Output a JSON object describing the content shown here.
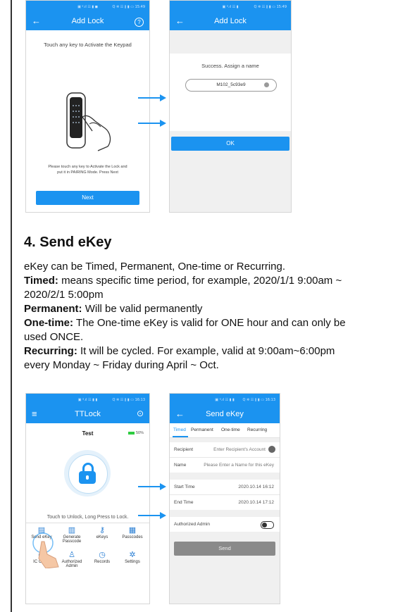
{
  "screens": {
    "add_lock_1": {
      "status": "▣ ᵍ.ıl ☷ ▮ ◼",
      "status_right": "Q ✲ ☷ ∦ ▮ ▭ 15:49",
      "title": "Add Lock",
      "back_icon": "←",
      "help_icon": "?",
      "instruction": "Touch any key to Activate the Keypad",
      "hint_line1": "Please touch any key to Activate the Lock and",
      "hint_line2": "put it in PAIRING Mode. Press Next",
      "next": "Next"
    },
    "add_lock_2": {
      "status": "▣ ᵍ.ıl ☷ ▮",
      "status_right": "Q ✲ ☷ ∦ ▮ ▭ 15:49",
      "title": "Add Lock",
      "back_icon": "←",
      "success": "Success. Assign a name",
      "name_value": "M102_5c93e9",
      "ok": "OK"
    },
    "ttlock": {
      "status": "▣ ᵍ.ıl ☷ ▮ ▮",
      "status_right": "Q ✲ ☷ ∦ ▮ ▭ 16:13",
      "title": "TTLock",
      "menu_icon": "≡",
      "scan_icon": "⊙",
      "lock_name": "Test",
      "battery": "50%",
      "unlock_hint": "Touch to Unlock, Long Press to Lock.",
      "grid": [
        "Send eKey",
        "Generate Passcode",
        "eKeys",
        "Passcodes",
        "IC Cards",
        "Authorized Admin",
        "Records",
        "Settings"
      ]
    },
    "send_ekey": {
      "status": "▣ ᵍ.ıl ☷ ▮ ▮",
      "status_right": "Q ✲ ☷ ∦ ▮ ▭ 16:13",
      "title": "Send eKey",
      "back_icon": "←",
      "tabs": [
        "Timed",
        "Permanent",
        "One-time",
        "Recurring"
      ],
      "recipient_label": "Recipient",
      "recipient_placeholder": "Enter Recipient's Account",
      "name_label": "Name",
      "name_placeholder": "Please Enter a Name for this eKey",
      "start_label": "Start Time",
      "start_value": "2020.10.14 16:12",
      "end_label": "End Time",
      "end_value": "2020.10.14 17:12",
      "admin_label": "Authorized Admin",
      "send": "Send"
    }
  },
  "section": {
    "heading": "4. Send eKey",
    "intro": "eKey can be Timed, Permanent, One-time or Recurring.",
    "timed_label": "Timed:",
    "timed_text_1": " means specific time period, for example, 2020/1/1 9:00am ~",
    "timed_text_2": "2020/2/1 5:00pm",
    "permanent_label": "Permanent:",
    "permanent_text": " Will be valid permanently",
    "onetime_label": "One-time:",
    "onetime_text_1": " The One-time eKey is valid for ONE hour and can only be",
    "onetime_text_2": "used ONCE.",
    "recurring_label": "Recurring:",
    "recurring_text_1": " It will be cycled. For example, valid at 9:00am~6:00pm",
    "recurring_text_2": "every Monday ~ Friday during April ~ Oct."
  },
  "colors": {
    "accent": "#1b93f0",
    "text": "#111111"
  }
}
